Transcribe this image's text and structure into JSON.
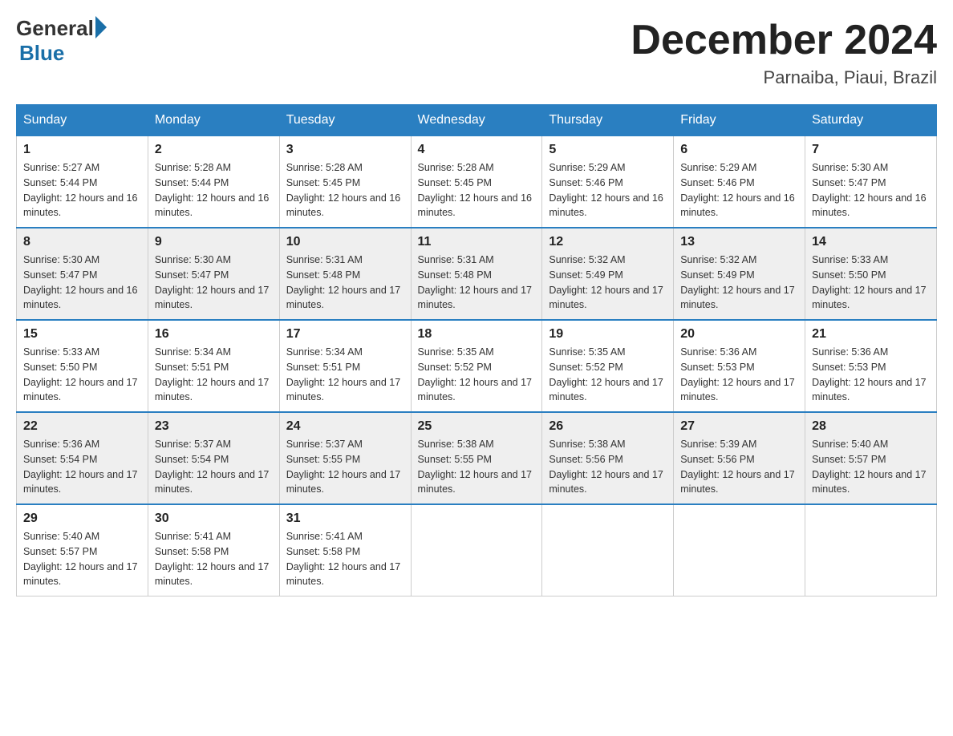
{
  "header": {
    "logo_general": "General",
    "logo_blue": "Blue",
    "month_title": "December 2024",
    "location": "Parnaiba, Piaui, Brazil"
  },
  "calendar": {
    "days_of_week": [
      "Sunday",
      "Monday",
      "Tuesday",
      "Wednesday",
      "Thursday",
      "Friday",
      "Saturday"
    ],
    "weeks": [
      [
        {
          "day": "1",
          "sunrise": "5:27 AM",
          "sunset": "5:44 PM",
          "daylight": "12 hours and 16 minutes."
        },
        {
          "day": "2",
          "sunrise": "5:28 AM",
          "sunset": "5:44 PM",
          "daylight": "12 hours and 16 minutes."
        },
        {
          "day": "3",
          "sunrise": "5:28 AM",
          "sunset": "5:45 PM",
          "daylight": "12 hours and 16 minutes."
        },
        {
          "day": "4",
          "sunrise": "5:28 AM",
          "sunset": "5:45 PM",
          "daylight": "12 hours and 16 minutes."
        },
        {
          "day": "5",
          "sunrise": "5:29 AM",
          "sunset": "5:46 PM",
          "daylight": "12 hours and 16 minutes."
        },
        {
          "day": "6",
          "sunrise": "5:29 AM",
          "sunset": "5:46 PM",
          "daylight": "12 hours and 16 minutes."
        },
        {
          "day": "7",
          "sunrise": "5:30 AM",
          "sunset": "5:47 PM",
          "daylight": "12 hours and 16 minutes."
        }
      ],
      [
        {
          "day": "8",
          "sunrise": "5:30 AM",
          "sunset": "5:47 PM",
          "daylight": "12 hours and 16 minutes."
        },
        {
          "day": "9",
          "sunrise": "5:30 AM",
          "sunset": "5:47 PM",
          "daylight": "12 hours and 17 minutes."
        },
        {
          "day": "10",
          "sunrise": "5:31 AM",
          "sunset": "5:48 PM",
          "daylight": "12 hours and 17 minutes."
        },
        {
          "day": "11",
          "sunrise": "5:31 AM",
          "sunset": "5:48 PM",
          "daylight": "12 hours and 17 minutes."
        },
        {
          "day": "12",
          "sunrise": "5:32 AM",
          "sunset": "5:49 PM",
          "daylight": "12 hours and 17 minutes."
        },
        {
          "day": "13",
          "sunrise": "5:32 AM",
          "sunset": "5:49 PM",
          "daylight": "12 hours and 17 minutes."
        },
        {
          "day": "14",
          "sunrise": "5:33 AM",
          "sunset": "5:50 PM",
          "daylight": "12 hours and 17 minutes."
        }
      ],
      [
        {
          "day": "15",
          "sunrise": "5:33 AM",
          "sunset": "5:50 PM",
          "daylight": "12 hours and 17 minutes."
        },
        {
          "day": "16",
          "sunrise": "5:34 AM",
          "sunset": "5:51 PM",
          "daylight": "12 hours and 17 minutes."
        },
        {
          "day": "17",
          "sunrise": "5:34 AM",
          "sunset": "5:51 PM",
          "daylight": "12 hours and 17 minutes."
        },
        {
          "day": "18",
          "sunrise": "5:35 AM",
          "sunset": "5:52 PM",
          "daylight": "12 hours and 17 minutes."
        },
        {
          "day": "19",
          "sunrise": "5:35 AM",
          "sunset": "5:52 PM",
          "daylight": "12 hours and 17 minutes."
        },
        {
          "day": "20",
          "sunrise": "5:36 AM",
          "sunset": "5:53 PM",
          "daylight": "12 hours and 17 minutes."
        },
        {
          "day": "21",
          "sunrise": "5:36 AM",
          "sunset": "5:53 PM",
          "daylight": "12 hours and 17 minutes."
        }
      ],
      [
        {
          "day": "22",
          "sunrise": "5:36 AM",
          "sunset": "5:54 PM",
          "daylight": "12 hours and 17 minutes."
        },
        {
          "day": "23",
          "sunrise": "5:37 AM",
          "sunset": "5:54 PM",
          "daylight": "12 hours and 17 minutes."
        },
        {
          "day": "24",
          "sunrise": "5:37 AM",
          "sunset": "5:55 PM",
          "daylight": "12 hours and 17 minutes."
        },
        {
          "day": "25",
          "sunrise": "5:38 AM",
          "sunset": "5:55 PM",
          "daylight": "12 hours and 17 minutes."
        },
        {
          "day": "26",
          "sunrise": "5:38 AM",
          "sunset": "5:56 PM",
          "daylight": "12 hours and 17 minutes."
        },
        {
          "day": "27",
          "sunrise": "5:39 AM",
          "sunset": "5:56 PM",
          "daylight": "12 hours and 17 minutes."
        },
        {
          "day": "28",
          "sunrise": "5:40 AM",
          "sunset": "5:57 PM",
          "daylight": "12 hours and 17 minutes."
        }
      ],
      [
        {
          "day": "29",
          "sunrise": "5:40 AM",
          "sunset": "5:57 PM",
          "daylight": "12 hours and 17 minutes."
        },
        {
          "day": "30",
          "sunrise": "5:41 AM",
          "sunset": "5:58 PM",
          "daylight": "12 hours and 17 minutes."
        },
        {
          "day": "31",
          "sunrise": "5:41 AM",
          "sunset": "5:58 PM",
          "daylight": "12 hours and 17 minutes."
        },
        null,
        null,
        null,
        null
      ]
    ]
  }
}
